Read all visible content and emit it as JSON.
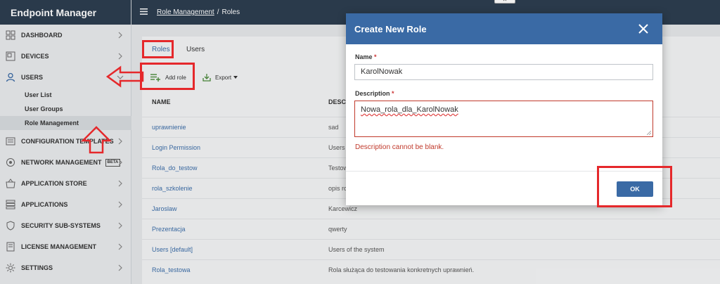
{
  "app": {
    "title": "Endpoint Manager"
  },
  "breadcrumb": {
    "parent": "Role Management",
    "separator": "/",
    "current": "Roles"
  },
  "sidebar": {
    "items": [
      {
        "label": "DASHBOARD",
        "icon": "dashboard-icon"
      },
      {
        "label": "DEVICES",
        "icon": "devices-icon"
      },
      {
        "label": "USERS",
        "icon": "user-icon",
        "active": true
      },
      {
        "label": "CONFIGURATION TEMPLATES",
        "icon": "templates-icon"
      },
      {
        "label": "NETWORK MANAGEMENT",
        "icon": "network-icon",
        "badge": "BETA"
      },
      {
        "label": "APPLICATION STORE",
        "icon": "store-icon"
      },
      {
        "label": "APPLICATIONS",
        "icon": "applications-icon"
      },
      {
        "label": "SECURITY SUB-SYSTEMS",
        "icon": "shield-icon"
      },
      {
        "label": "LICENSE MANAGEMENT",
        "icon": "license-icon"
      },
      {
        "label": "SETTINGS",
        "icon": "gear-icon"
      }
    ],
    "subitems": [
      {
        "label": "User List"
      },
      {
        "label": "User Groups"
      },
      {
        "label": "Role Management",
        "active": true
      }
    ]
  },
  "tabs": [
    {
      "label": "Roles",
      "active": true
    },
    {
      "label": "Users"
    }
  ],
  "toolbar": {
    "add_role": "Add role",
    "export": "Export"
  },
  "table": {
    "columns": [
      "NAME",
      "DESCR"
    ],
    "rows": [
      {
        "name": "uprawnienie",
        "description": "sad"
      },
      {
        "name": "Login Permission",
        "description": "Users"
      },
      {
        "name": "Rola_do_testow",
        "description": "Testow"
      },
      {
        "name": "rola_szkolenie",
        "description": "opis ro"
      },
      {
        "name": "Jaroslaw",
        "description": "Karcewicz"
      },
      {
        "name": "Prezentacja",
        "description": "qwerty"
      },
      {
        "name": "Users [default]",
        "description": "Users of the system"
      },
      {
        "name": "Rola_testowa",
        "description": "Rola służąca do testowania konkretnych uprawnień."
      }
    ]
  },
  "modal": {
    "title": "Create New Role",
    "name_label": "Name",
    "name_value": "KarolNowak",
    "description_label": "Description",
    "description_value": "Nowa_rola_dla_KarolNowak",
    "required_mark": "*",
    "error": "Description cannot be blank.",
    "ok_label": "OK"
  },
  "colors": {
    "header": "#2d3e50",
    "accent": "#3a6aa5",
    "error": "#c0392b",
    "annotation": "#e5282b"
  }
}
